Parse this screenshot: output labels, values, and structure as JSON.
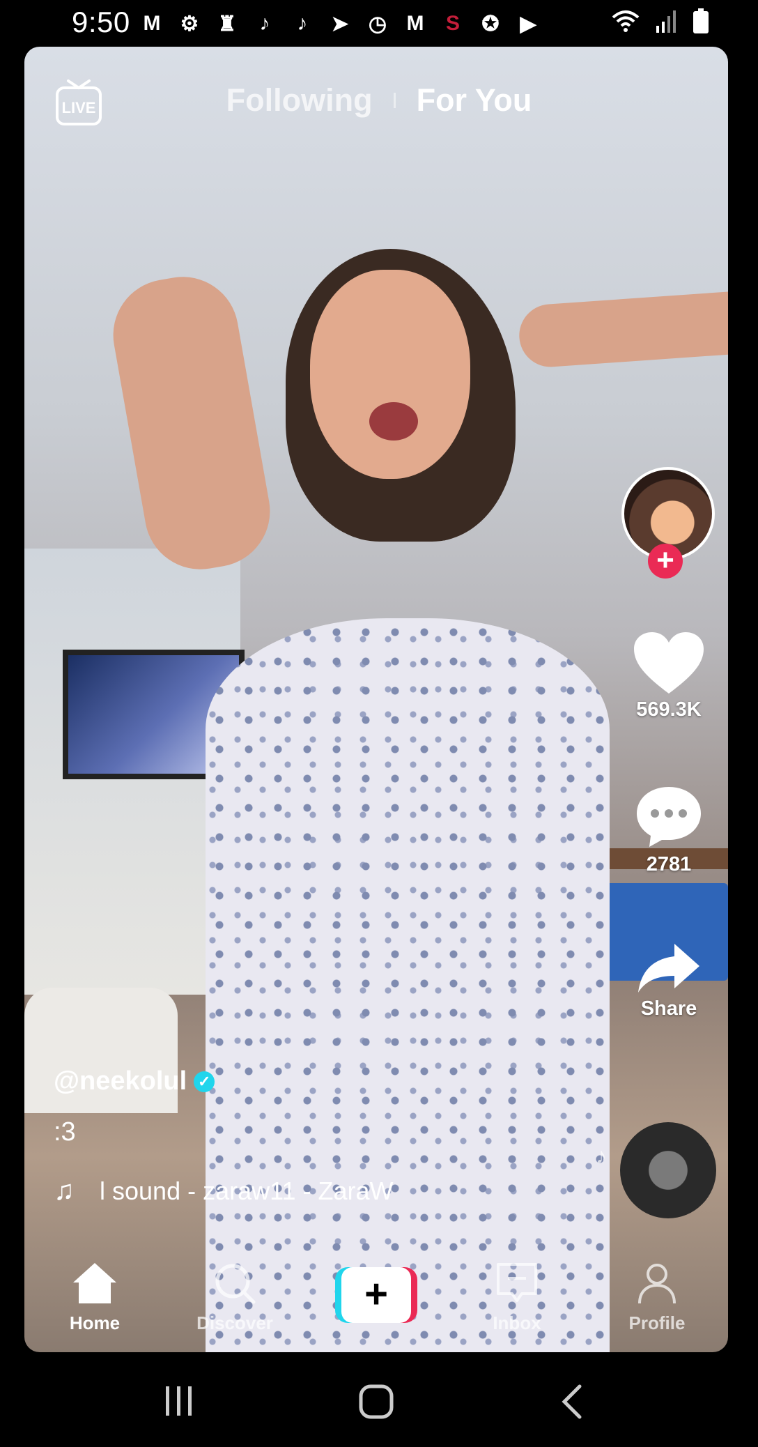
{
  "status_bar": {
    "time": "9:50",
    "notification_icons": [
      "gmail-icon",
      "settings-icon",
      "chess-icon",
      "tiktok-icon",
      "tiktok-icon",
      "sprint-icon",
      "clock-app-icon",
      "gmail-icon",
      "stanford-icon",
      "star-icon",
      "youtube-icon"
    ],
    "system_icons": [
      "wifi-icon",
      "signal-icon",
      "battery-icon"
    ]
  },
  "header": {
    "live_label": "LIVE",
    "tabs": [
      {
        "label": "Following",
        "active": false
      },
      {
        "label": "For You",
        "active": true
      }
    ]
  },
  "rail": {
    "likes": "569.3K",
    "comments": "2781",
    "share_label": "Share"
  },
  "caption": {
    "username": "@neekolul",
    "description": ":3",
    "sound": "l sound - zaraw11 - ZaraW"
  },
  "bottom_nav": {
    "items": [
      {
        "label": "Home",
        "icon": "home-icon",
        "active": true
      },
      {
        "label": "Discover",
        "icon": "search-icon",
        "active": false
      },
      {
        "label": "",
        "icon": "create-icon",
        "active": false
      },
      {
        "label": "Inbox",
        "icon": "inbox-icon",
        "active": false
      },
      {
        "label": "Profile",
        "icon": "profile-icon",
        "active": false
      }
    ]
  },
  "colors": {
    "accent_red": "#ea2a55",
    "accent_cyan": "#20d5ec"
  }
}
